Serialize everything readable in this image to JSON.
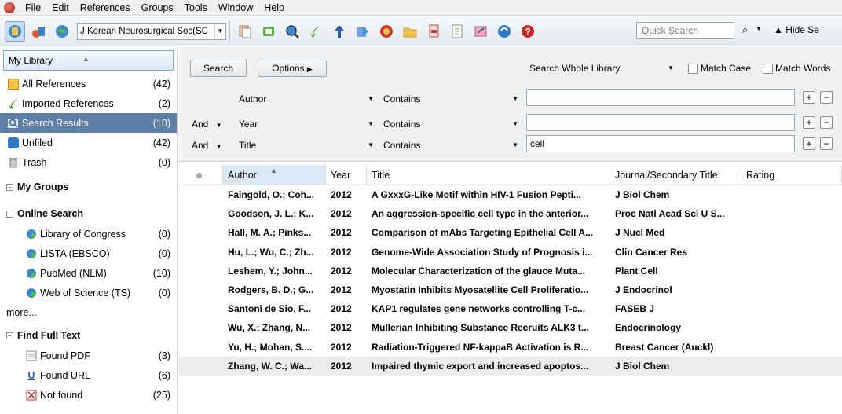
{
  "menu": [
    "File",
    "Edit",
    "References",
    "Groups",
    "Tools",
    "Window",
    "Help"
  ],
  "toolbar": {
    "style_value": "J Korean Neurosurgical Soc(SC",
    "quick_search_placeholder": "Quick Search",
    "hide_search": "Hide Se"
  },
  "left": {
    "header": "My Library",
    "library": [
      {
        "label": "All References",
        "count": "(42)"
      },
      {
        "label": "Imported References",
        "count": "(2)"
      },
      {
        "label": "Search Results",
        "count": "(10)"
      },
      {
        "label": "Unfiled",
        "count": "(42)"
      },
      {
        "label": "Trash",
        "count": "(0)"
      }
    ],
    "groups": {
      "my_groups": "My Groups",
      "online_search": "Online Search",
      "online_items": [
        {
          "label": "Library of Congress",
          "count": "(0)"
        },
        {
          "label": "LISTA (EBSCO)",
          "count": "(0)"
        },
        {
          "label": "PubMed (NLM)",
          "count": "(10)"
        },
        {
          "label": "Web of Science (TS)",
          "count": "(0)"
        }
      ],
      "more": "more...",
      "find_full_text": "Find Full Text",
      "fft_items": [
        {
          "label": "Found PDF",
          "count": "(3)"
        },
        {
          "label": "Found URL",
          "count": "(6)"
        },
        {
          "label": "Not found",
          "count": "(25)"
        }
      ]
    }
  },
  "search": {
    "search_btn": "Search",
    "options_btn": "Options",
    "scope": "Search Whole Library",
    "match_case": "Match Case",
    "match_words": "Match Words",
    "rows": [
      {
        "bool": "",
        "field": "Author",
        "op": "Contains",
        "value": ""
      },
      {
        "bool": "And",
        "field": "Year",
        "op": "Contains",
        "value": ""
      },
      {
        "bool": "And",
        "field": "Title",
        "op": "Contains",
        "value": "cell"
      }
    ]
  },
  "results": {
    "columns": [
      "Author",
      "Year",
      "Title",
      "Journal/Secondary Title",
      "Rating"
    ],
    "rows": [
      {
        "author": "Faingold, O.; Coh...",
        "year": "2012",
        "title": "A GxxxG-Like Motif within HIV-1 Fusion Pepti...",
        "journal": "J Biol Chem"
      },
      {
        "author": "Goodson, J. L.; K...",
        "year": "2012",
        "title": "An aggression-specific cell type in the anterior...",
        "journal": "Proc Natl Acad Sci U S..."
      },
      {
        "author": "Hall, M. A.; Pinks...",
        "year": "2012",
        "title": "Comparison of mAbs Targeting Epithelial Cell A...",
        "journal": "J Nucl Med"
      },
      {
        "author": "Hu, L.; Wu, C.; Zh...",
        "year": "2012",
        "title": "Genome-Wide Association Study of Prognosis i...",
        "journal": "Clin Cancer Res"
      },
      {
        "author": "Leshem, Y.; John...",
        "year": "2012",
        "title": "Molecular Characterization of the glauce Muta...",
        "journal": "Plant Cell"
      },
      {
        "author": "Rodgers, B. D.; G...",
        "year": "2012",
        "title": "Myostatin Inhibits Myosatellite Cell Proliferatio...",
        "journal": "J Endocrinol"
      },
      {
        "author": "Santoni de Sio, F...",
        "year": "2012",
        "title": "KAP1 regulates gene networks controlling T-c...",
        "journal": "FASEB J"
      },
      {
        "author": "Wu, X.; Zhang, N...",
        "year": "2012",
        "title": "Mullerian Inhibiting Substance Recruits ALK3 t...",
        "journal": "Endocrinology"
      },
      {
        "author": "Yu, H.; Mohan, S....",
        "year": "2012",
        "title": "Radiation-Triggered NF-kappaB Activation is R...",
        "journal": "Breast Cancer (Auckl)"
      },
      {
        "author": "Zhang, W. C.; Wa...",
        "year": "2012",
        "title": "Impaired thymic export and increased apoptos...",
        "journal": "J Biol Chem"
      }
    ]
  }
}
